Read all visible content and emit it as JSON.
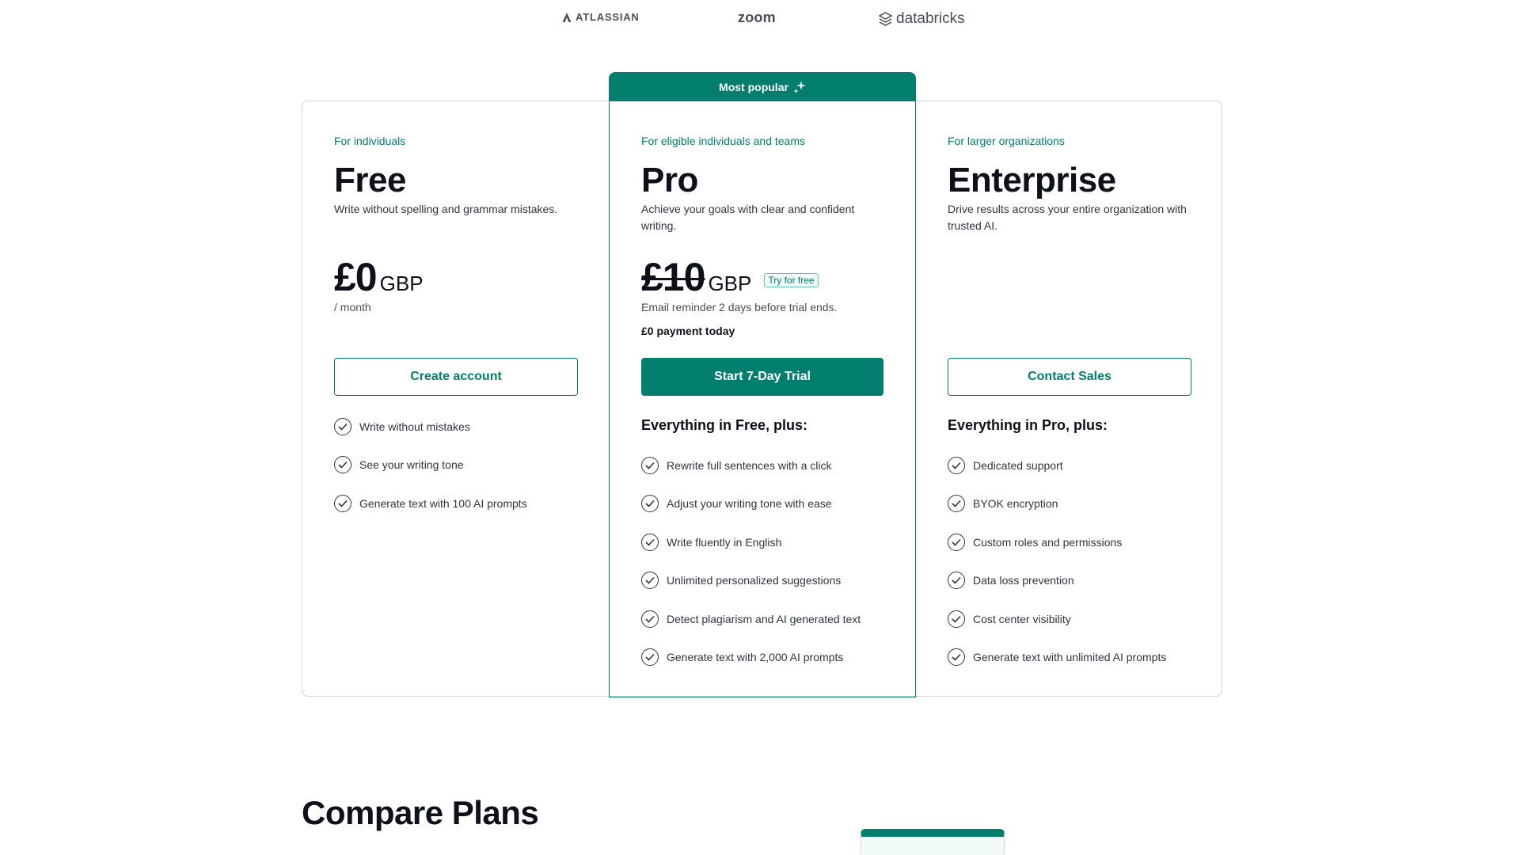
{
  "logos": {
    "atlassian": "ATLASSIAN",
    "zoom": "zoom",
    "databricks": "databricks"
  },
  "colors": {
    "brand": "#027e6f",
    "text": "#0e101a",
    "muted": "#4a4d57",
    "border": "#d4d6db"
  },
  "popular_label": "Most popular",
  "plans": {
    "free": {
      "audience": "For individuals",
      "name": "Free",
      "description": "Write without spelling and grammar mistakes.",
      "price": "£0",
      "currency": "GBP",
      "period": "/ month",
      "cta": "Create account",
      "features": [
        "Write without mistakes",
        "See your writing tone",
        "Generate text with 100 AI prompts"
      ]
    },
    "pro": {
      "audience": "For eligible individuals and teams",
      "name": "Pro",
      "description": "Achieve your goals with clear and confident writing.",
      "price": "£10",
      "currency": "GBP",
      "badge": "Try for free",
      "trial_note": "Email reminder 2 days before trial ends.",
      "payment_today": "£0 payment today",
      "cta": "Start 7-Day Trial",
      "features_heading": "Everything in Free, plus:",
      "features": [
        "Rewrite full sentences with a click",
        "Adjust your writing tone with ease",
        "Write fluently in English",
        "Unlimited personalized suggestions",
        "Detect plagiarism and AI generated text",
        "Generate text with 2,000 AI prompts"
      ]
    },
    "enterprise": {
      "audience": "For larger organizations",
      "name": "Enterprise",
      "description": "Drive results across your entire organization with trusted AI.",
      "cta": "Contact Sales",
      "features_heading": "Everything in Pro, plus:",
      "features": [
        "Dedicated support",
        "BYOK encryption",
        "Custom roles and permissions",
        "Data loss prevention",
        "Cost center visibility",
        "Generate text with unlimited AI prompts"
      ]
    }
  },
  "compare": {
    "title": "Compare Plans"
  }
}
